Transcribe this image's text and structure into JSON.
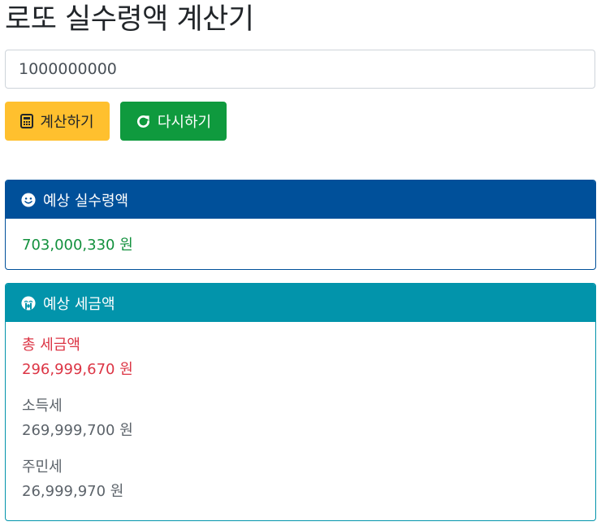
{
  "header": {
    "title": "로또 실수령액 계산기"
  },
  "input": {
    "value": "1000000000"
  },
  "buttons": {
    "calculate_label": "계산하기",
    "reset_label": "다시하기"
  },
  "net_card": {
    "title": "예상 실수령액",
    "value": "703,000,330 원"
  },
  "tax_card": {
    "title": "예상 세금액",
    "total_label": "총 세금액",
    "total_value": "296,999,670 원",
    "income_tax_label": "소득세",
    "income_tax_value": "269,999,700 원",
    "resident_tax_label": "주민세",
    "resident_tax_value": "26,999,970 원"
  },
  "icons": {
    "calculate": "calculator-icon",
    "reset": "redo-icon",
    "net": "smile-icon",
    "tax": "sad-cry-icon"
  },
  "colors": {
    "calculate_button": "#ffc02e",
    "reset_button": "#0f9a3e",
    "net_header": "#00509a",
    "tax_header": "#0294ab",
    "net_value": "#13913e",
    "tax_total": "#dc3545"
  }
}
